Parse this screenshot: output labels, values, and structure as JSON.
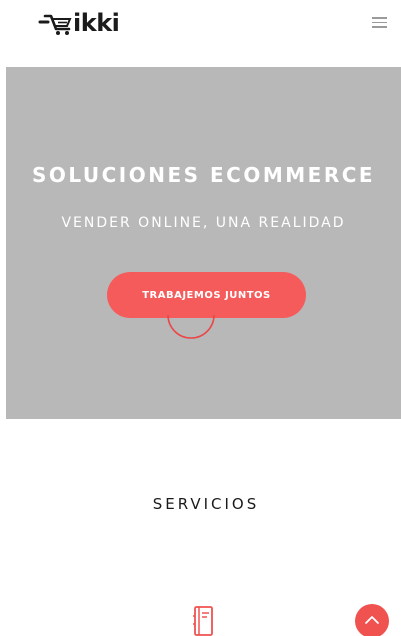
{
  "header": {
    "logo_text": "ikki",
    "logo_icon": "cart-logo-icon",
    "menu_icon": "hamburger-menu-icon"
  },
  "hero": {
    "title": "SOLUCIONES ECOMMERCE",
    "subtitle": "VENDER ONLINE, UNA REALIDAD",
    "cta_label": "TRABAJEMOS JUNTOS",
    "background_color": "#b8b8b8",
    "accent_color": "#f55b5b"
  },
  "services": {
    "title": "SERVICIOS",
    "first_icon": "document-icon"
  },
  "scroll_top": {
    "icon": "chevron-up-icon",
    "color": "#f0524f"
  }
}
